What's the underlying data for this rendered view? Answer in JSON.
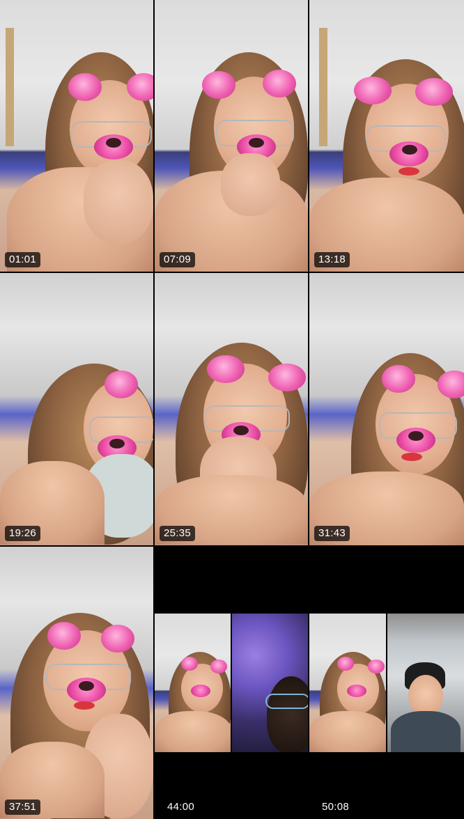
{
  "thumbnails": [
    {
      "time": "01:01"
    },
    {
      "time": "07:09"
    },
    {
      "time": "13:18"
    },
    {
      "time": "19:26"
    },
    {
      "time": "25:35"
    },
    {
      "time": "31:43"
    },
    {
      "time": "37:51"
    },
    {
      "time": "44:00"
    },
    {
      "time": "50:08"
    }
  ]
}
